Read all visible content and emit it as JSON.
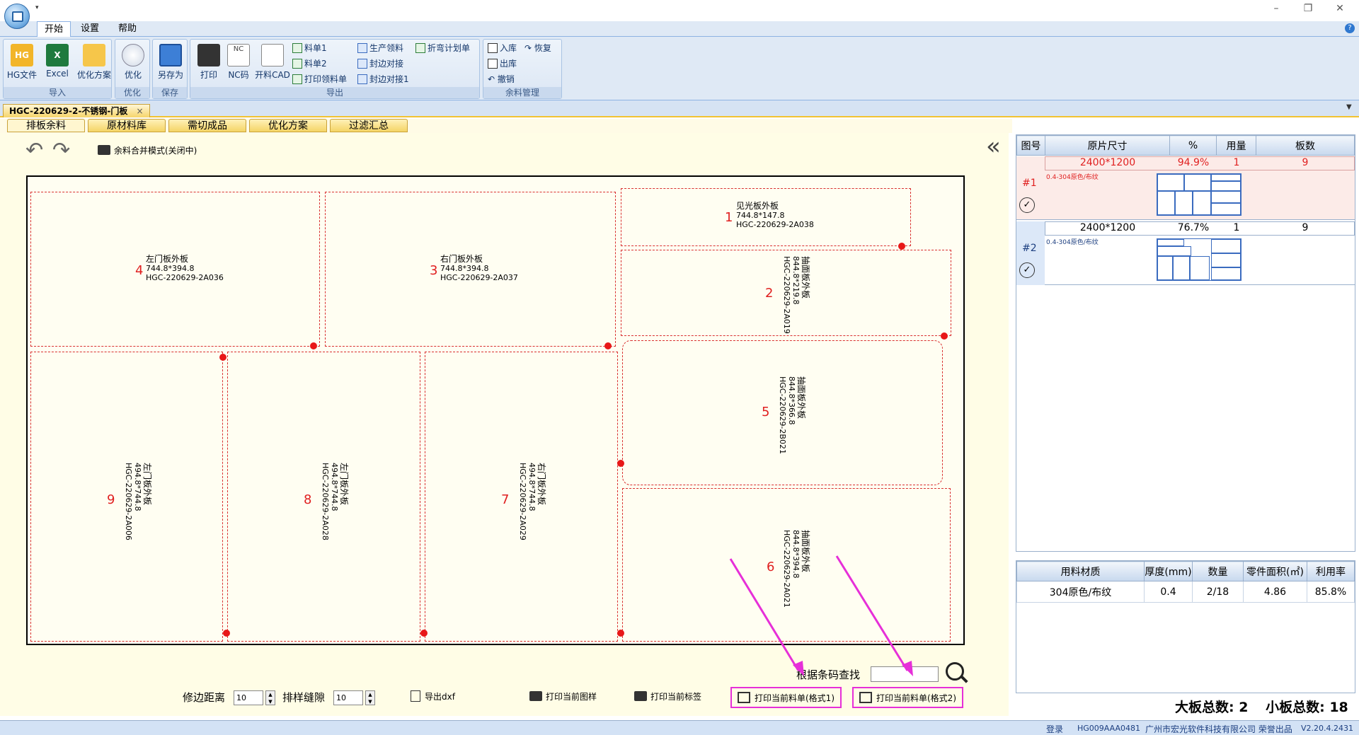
{
  "ribbon": {
    "tabs": [
      "开始",
      "设置",
      "帮助"
    ],
    "groups": [
      {
        "label": "导入",
        "buttons": [
          "HG文件",
          "Excel",
          "优化方案"
        ]
      },
      {
        "label": "优化",
        "buttons": [
          "优化"
        ]
      },
      {
        "label": "保存",
        "buttons": [
          "另存为"
        ]
      },
      {
        "label": "导出",
        "buttons": [
          "打印",
          "NC码",
          "开料CAD"
        ],
        "small": [
          "料单1",
          "料单2",
          "打印领料单",
          "生产领料",
          "封边对接",
          "封边对接1",
          "折弯计划单"
        ]
      },
      {
        "label": "余料管理",
        "small": [
          "入库",
          "恢复",
          "出库",
          "撤销"
        ]
      }
    ],
    "icon_texts": {
      "hg": "HG",
      "nc": "NC"
    }
  },
  "doc_tab": "HGC-220629-2-不锈钢-门板",
  "sub_tabs": [
    "排板余料",
    "原材料库",
    "需切成品",
    "优化方案",
    "过滤汇总"
  ],
  "toolbar": {
    "merge_mode": "余料合并模式(关闭中)"
  },
  "parts": [
    {
      "num": "1",
      "name": "见光板外板",
      "size": "744.8*147.8",
      "code": "HGC-220629-2A038"
    },
    {
      "num": "2",
      "name": "抽面板外板",
      "size": "844.8*219.8",
      "code": "HGC-220629-2A019"
    },
    {
      "num": "3",
      "name": "右门板外板",
      "size": "744.8*394.8",
      "code": "HGC-220629-2A037"
    },
    {
      "num": "4",
      "name": "左门板外板",
      "size": "744.8*394.8",
      "code": "HGC-220629-2A036"
    },
    {
      "num": "5",
      "name": "抽面板外板",
      "size": "844.8*366.8",
      "code": "HGC-220629-2B021"
    },
    {
      "num": "6",
      "name": "抽面板外板",
      "size": "844.8*394.8",
      "code": "HGC-220629-2A021"
    },
    {
      "num": "7",
      "name": "右门板外板",
      "size": "494.8*744.8",
      "code": "HGC-220629-2A029"
    },
    {
      "num": "8",
      "name": "左门板外板",
      "size": "494.8*744.8",
      "code": "HGC-220629-2A028"
    },
    {
      "num": "9",
      "name": "左门板外板",
      "size": "494.8*744.8",
      "code": "HGC-220629-2A006"
    }
  ],
  "bottom": {
    "trim_label": "修边距离",
    "trim_value": "10",
    "gap_label": "排样缝隙",
    "gap_value": "10",
    "export_dxf": "导出dxf",
    "print_sheet": "打印当前图样",
    "print_label": "打印当前标签",
    "print_list1": "打印当前料单(格式1)",
    "print_list2": "打印当前料单(格式2)",
    "barcode_label": "根据条码查找"
  },
  "sheets": {
    "headers": [
      "图号",
      "原片尺寸",
      "%",
      "用量",
      "板数"
    ],
    "rows": [
      {
        "id": "#1",
        "size": "2400*1200",
        "pct": "94.9%",
        "qty": "1",
        "boards": "9",
        "mat": "0.4-304原色/布纹"
      },
      {
        "id": "#2",
        "size": "2400*1200",
        "pct": "76.7%",
        "qty": "1",
        "boards": "9",
        "mat": "0.4-304原色/布纹"
      }
    ]
  },
  "stats": {
    "headers": [
      "用料材质",
      "厚度(mm)",
      "数量",
      "零件面积(㎡)",
      "利用率"
    ],
    "row": [
      "304原色/布纹",
      "0.4",
      "2/18",
      "4.86",
      "85.8%"
    ]
  },
  "totals": {
    "big_label": "大板总数:",
    "big": "2",
    "small_label": "小板总数:",
    "small": "18"
  },
  "status": {
    "login": "登录",
    "id": "HG009AAA0481",
    "company": "广州市宏光软件科技有限公司 荣誉出品",
    "version": "V2.20.4.2431"
  }
}
